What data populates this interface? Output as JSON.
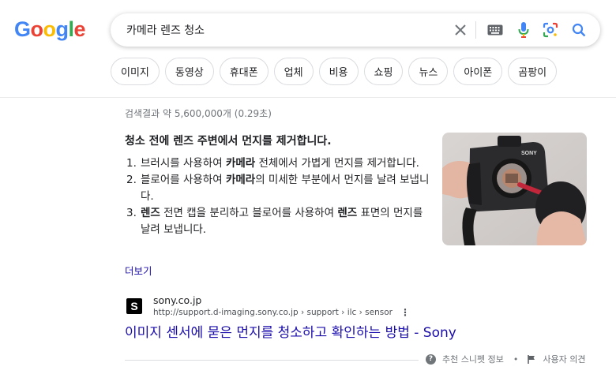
{
  "logo": {
    "letters": [
      "G",
      "o",
      "o",
      "g",
      "l",
      "e"
    ],
    "colors": [
      "#4285F4",
      "#EA4335",
      "#FBBC05",
      "#4285F4",
      "#34A853",
      "#EA4335"
    ]
  },
  "search": {
    "query": "카메라 렌즈 청소"
  },
  "icons": {
    "clear": "close-icon",
    "keyboard": "keyboard-icon",
    "mic": "mic-icon",
    "lens": "google-lens-icon",
    "search": "search-icon"
  },
  "chips": [
    "이미지",
    "동영상",
    "휴대폰",
    "업체",
    "비용",
    "쇼핑",
    "뉴스",
    "아이폰",
    "곰팡이"
  ],
  "stats": "검색결과 약 5,600,000개 (0.29초)",
  "snippet": {
    "title": "청소 전에 렌즈 주변에서 먼지를 제거합니다.",
    "steps": [
      {
        "num": "1.",
        "parts": [
          {
            "t": "브러시를 사용하여 "
          },
          {
            "t": "카메라",
            "b": true
          },
          {
            "t": " 전체에서 가볍게 먼지를 제거합니다."
          }
        ]
      },
      {
        "num": "2.",
        "parts": [
          {
            "t": "블로어를 사용하여 "
          },
          {
            "t": "카메라",
            "b": true
          },
          {
            "t": "의 미세한 부분에서 먼지를 날려 보냅니다."
          }
        ]
      },
      {
        "num": "3.",
        "parts": [
          {
            "t": "렌즈",
            "b": true
          },
          {
            "t": " 전면 캡을 분리하고 블로어를 사용하여 "
          },
          {
            "t": "렌즈",
            "b": true
          },
          {
            "t": " 표면의 먼지를 날려 보냅니다."
          }
        ]
      }
    ],
    "more": "더보기",
    "image_brand": "SONY"
  },
  "result": {
    "favicon": "S",
    "site_name": "sony.co.jp",
    "url": "http://support.d-imaging.sony.co.jp › support › ilc › sensor",
    "menu": "⋮",
    "title": "이미지 센서에 묻은 먼지를 청소하고 확인하는 방법 - Sony"
  },
  "footer": {
    "about": "추천 스니펫 정보",
    "bullet": "•",
    "feedback": "사용자 의견"
  }
}
